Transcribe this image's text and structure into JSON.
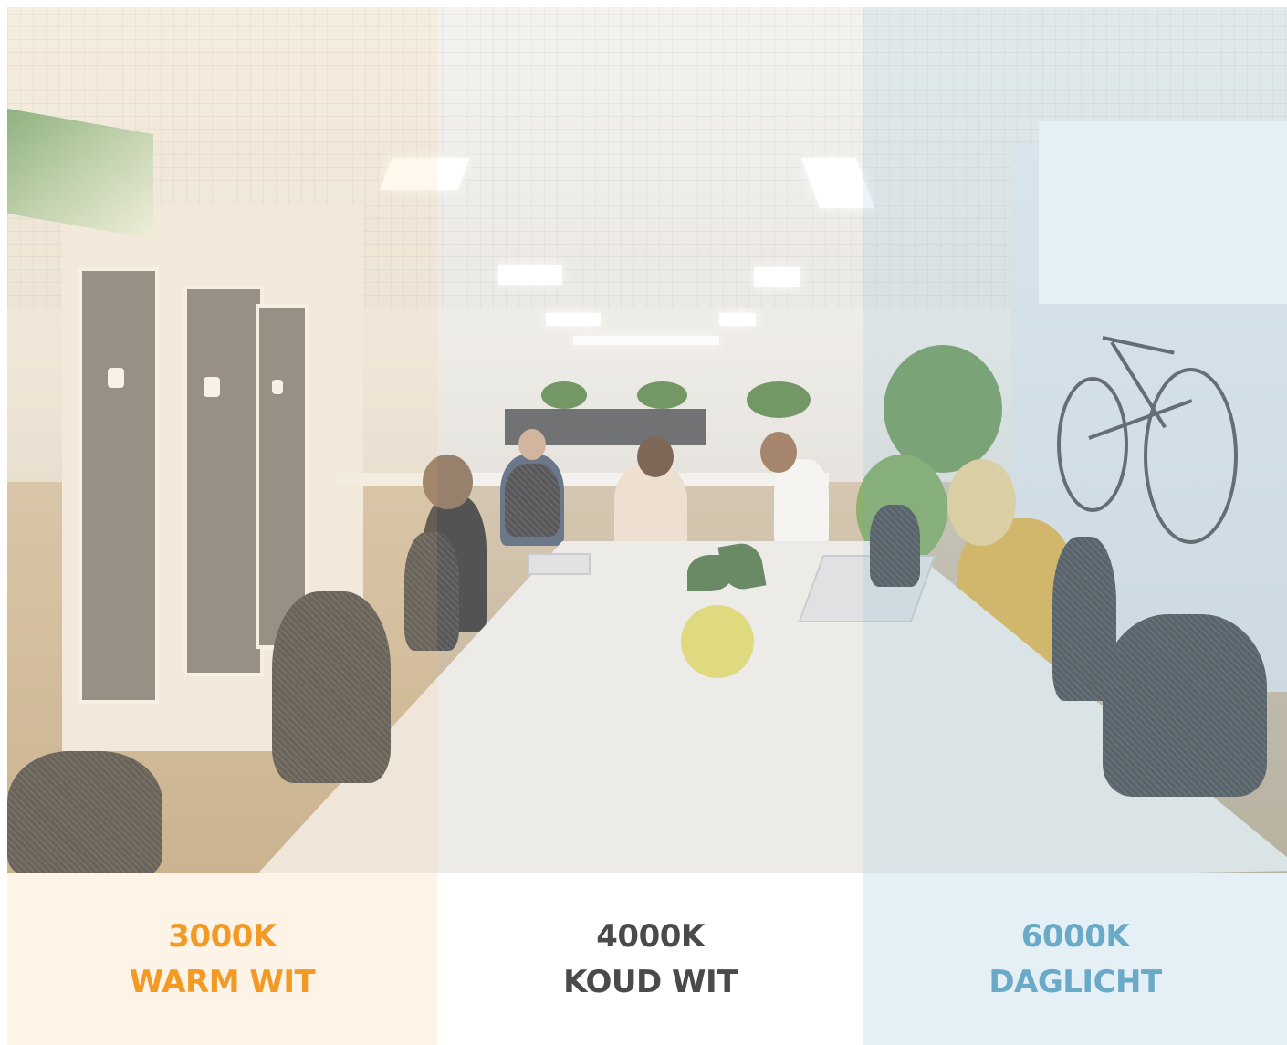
{
  "colors": {
    "warm": "#f39a24",
    "neutral": "#4a4a4a",
    "cool": "#6aaac8"
  },
  "panels": [
    {
      "kelvin": "3000K",
      "name": "WARM WIT"
    },
    {
      "kelvin": "4000K",
      "name": "KOUD WIT"
    },
    {
      "kelvin": "6000K",
      "name": "DAGLICHT"
    }
  ]
}
